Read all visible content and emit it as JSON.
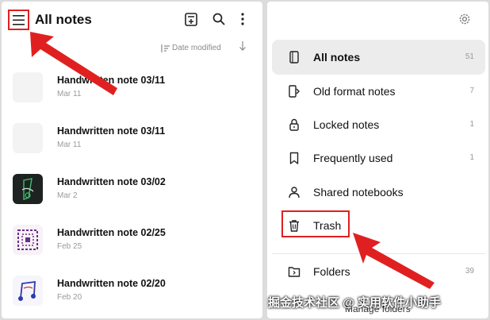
{
  "left": {
    "title": "All notes",
    "sort_label": "Date modified",
    "notes": [
      {
        "title": "Handwritten note 03/11",
        "date": "Mar 11"
      },
      {
        "title": "Handwritten note 03/11",
        "date": "Mar 11"
      },
      {
        "title": "Handwritten note 03/02",
        "date": "Mar 2"
      },
      {
        "title": "Handwritten note 02/25",
        "date": "Feb 25"
      },
      {
        "title": "Handwritten note 02/20",
        "date": "Feb 20"
      }
    ]
  },
  "right": {
    "items": [
      {
        "label": "All notes",
        "count": "51",
        "icon": "note-icon"
      },
      {
        "label": "Old format notes",
        "count": "7",
        "icon": "old-format-icon"
      },
      {
        "label": "Locked notes",
        "count": "1",
        "icon": "lock-icon"
      },
      {
        "label": "Frequently used",
        "count": "1",
        "icon": "bookmark-icon"
      },
      {
        "label": "Shared notebooks",
        "count": "",
        "icon": "person-icon"
      },
      {
        "label": "Trash",
        "count": "",
        "icon": "trash-icon"
      },
      {
        "label": "Folders",
        "count": "39",
        "icon": "folder-icon"
      }
    ],
    "manage_label": "Manage folders"
  },
  "watermark": "掘金技术社区 @ 实用软件小助手",
  "colors": {
    "highlight": "#e02020",
    "selected_bg": "#ececec"
  }
}
